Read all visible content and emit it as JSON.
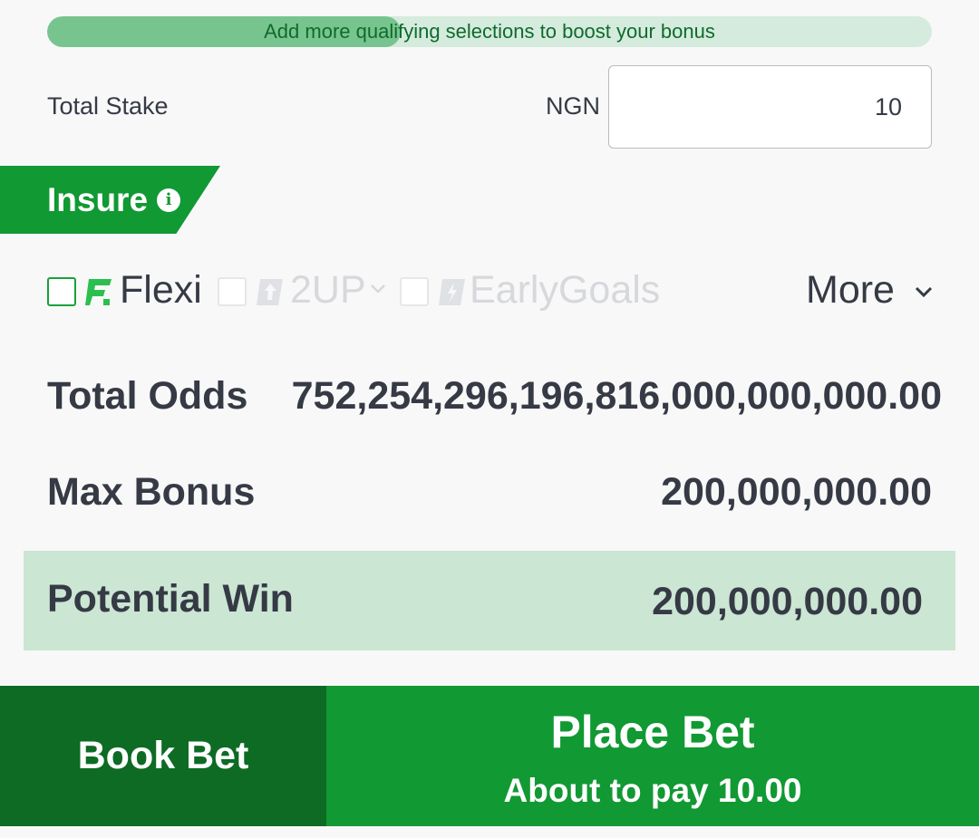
{
  "bonus_progress": {
    "message": "Add more qualifying selections to boost your bonus",
    "fill_fraction": 0.4
  },
  "stake": {
    "label": "Total Stake",
    "currency": "NGN",
    "value": "10"
  },
  "insure": {
    "label": "Insure",
    "icon": "info-icon"
  },
  "options": {
    "flexi": {
      "label": "Flexi",
      "icon": "flexi-icon",
      "checked": false,
      "enabled": true
    },
    "two_up": {
      "label": "2UP",
      "icon": "two-up-icon",
      "checked": false,
      "enabled": false
    },
    "early_goals": {
      "label": "EarlyGoals",
      "icon": "early-goals-icon",
      "checked": false,
      "enabled": false
    },
    "more_label": "More"
  },
  "summary": {
    "total_odds_label": "Total Odds",
    "total_odds_value": "752,254,296,196,816,000,000,000.00",
    "max_bonus_label": "Max Bonus",
    "max_bonus_value": "200,000,000.00",
    "potential_win_label": "Potential Win",
    "potential_win_value": "200,000,000.00"
  },
  "actions": {
    "book_bet_label": "Book Bet",
    "place_bet_label": "Place Bet",
    "place_bet_sub": "About to pay 10.00"
  },
  "colors": {
    "brand_green": "#119933",
    "dark_green": "#0d6b24",
    "progress_track": "#d5ebdd",
    "progress_fill": "#78c48f",
    "win_highlight": "#cbe6d3"
  }
}
